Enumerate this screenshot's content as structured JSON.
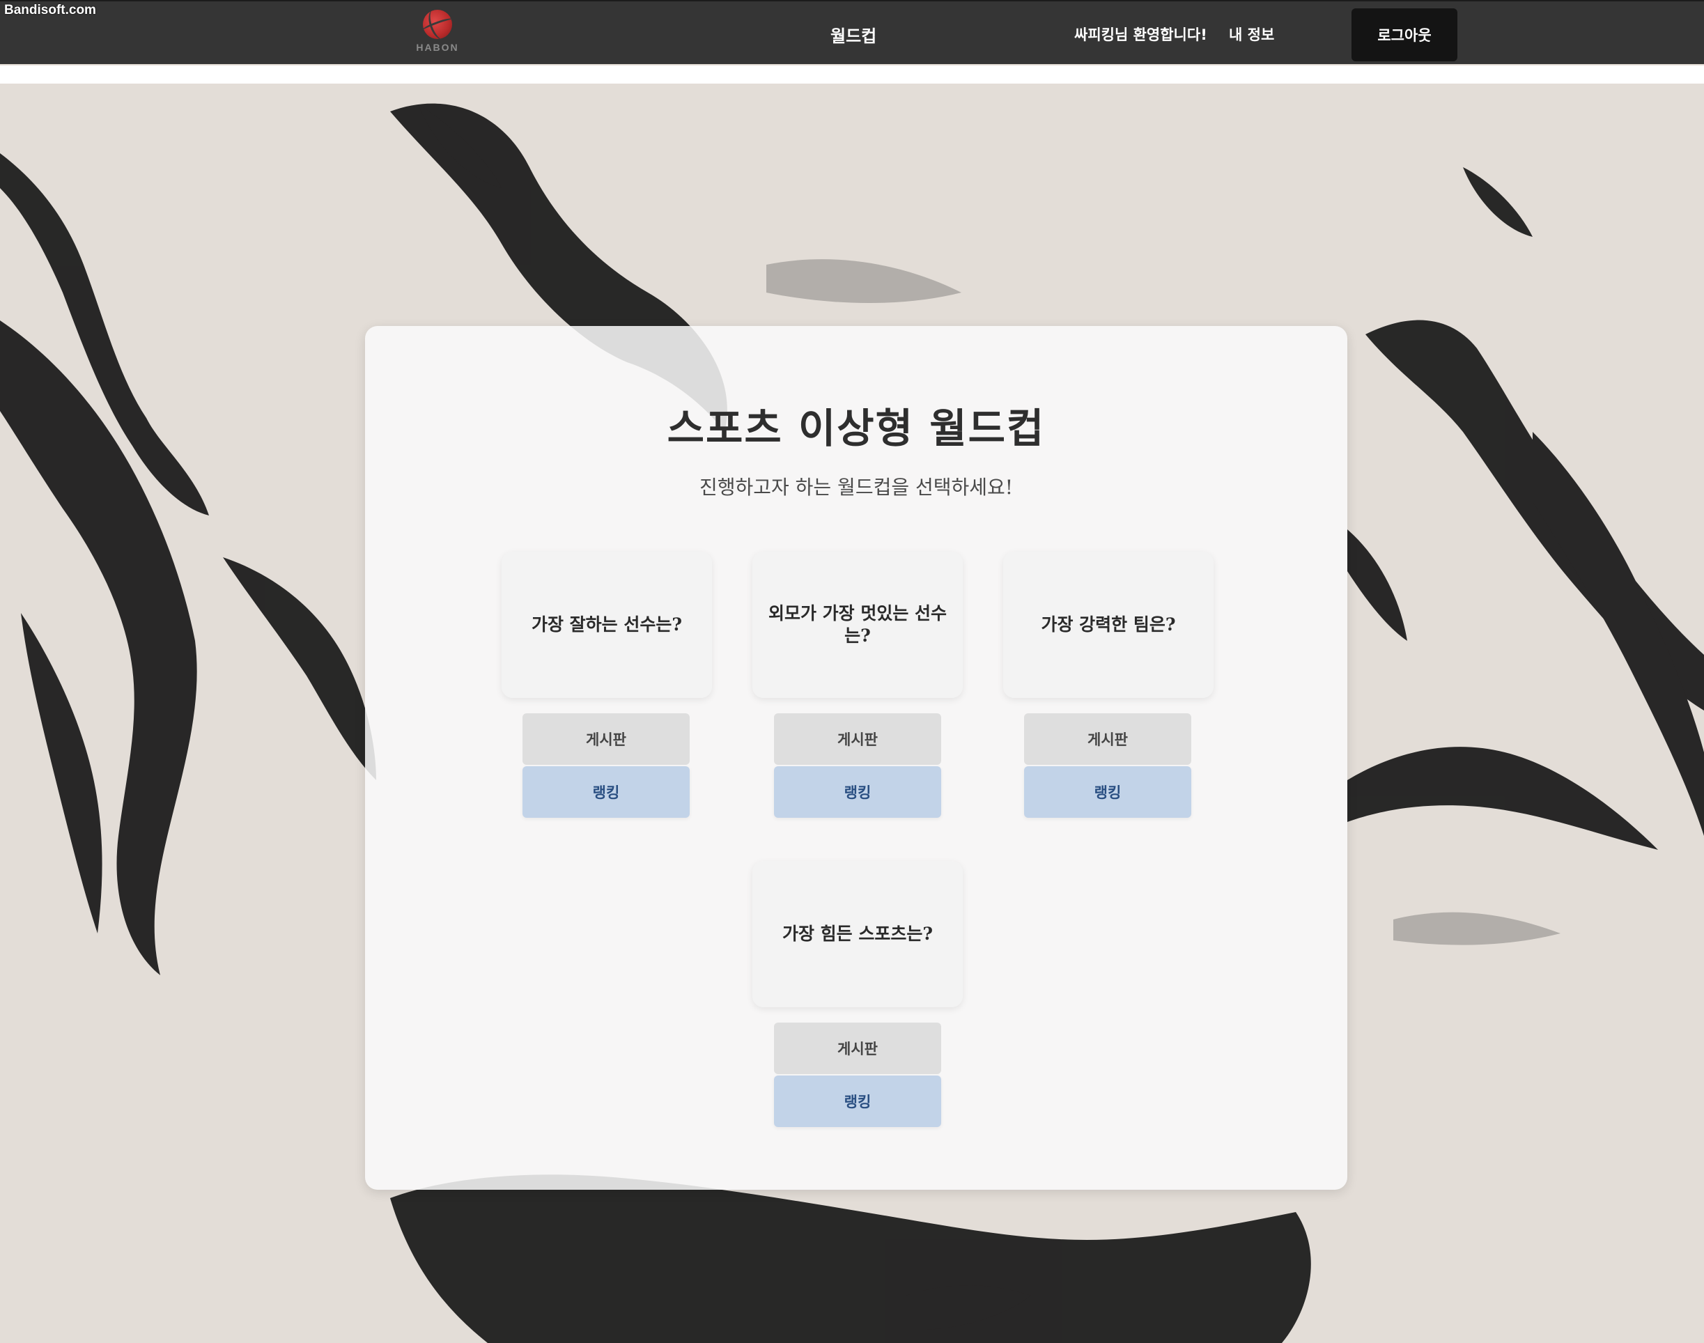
{
  "watermark": "Bandisoft.com",
  "header": {
    "logo_text": "HABON",
    "nav_worldcup": "월드컵",
    "welcome": "싸피킹님 환영합니다!",
    "my_info": "내 정보",
    "logout": "로그아웃"
  },
  "main": {
    "title": "스포츠 이상형 월드컵",
    "subtitle": "진행하고자 하는 월드컵을 선택하세요!",
    "worldcups": [
      {
        "title": "가장 잘하는 선수는?",
        "board": "게시판",
        "ranking": "랭킹"
      },
      {
        "title": "외모가 가장 멋있는 선수는?",
        "board": "게시판",
        "ranking": "랭킹"
      },
      {
        "title": "가장 강력한 팀은?",
        "board": "게시판",
        "ranking": "랭킹"
      },
      {
        "title": "가장 힘든 스포츠는?",
        "board": "게시판",
        "ranking": "랭킹"
      }
    ]
  },
  "colors": {
    "header_bg": "#353535",
    "logout_bg": "#141414",
    "ranking_bg": "#c2d3e8",
    "ranking_text": "#2a4f82",
    "board_bg": "#dedede"
  },
  "icons": [
    "habon-logo-ball-icon"
  ]
}
